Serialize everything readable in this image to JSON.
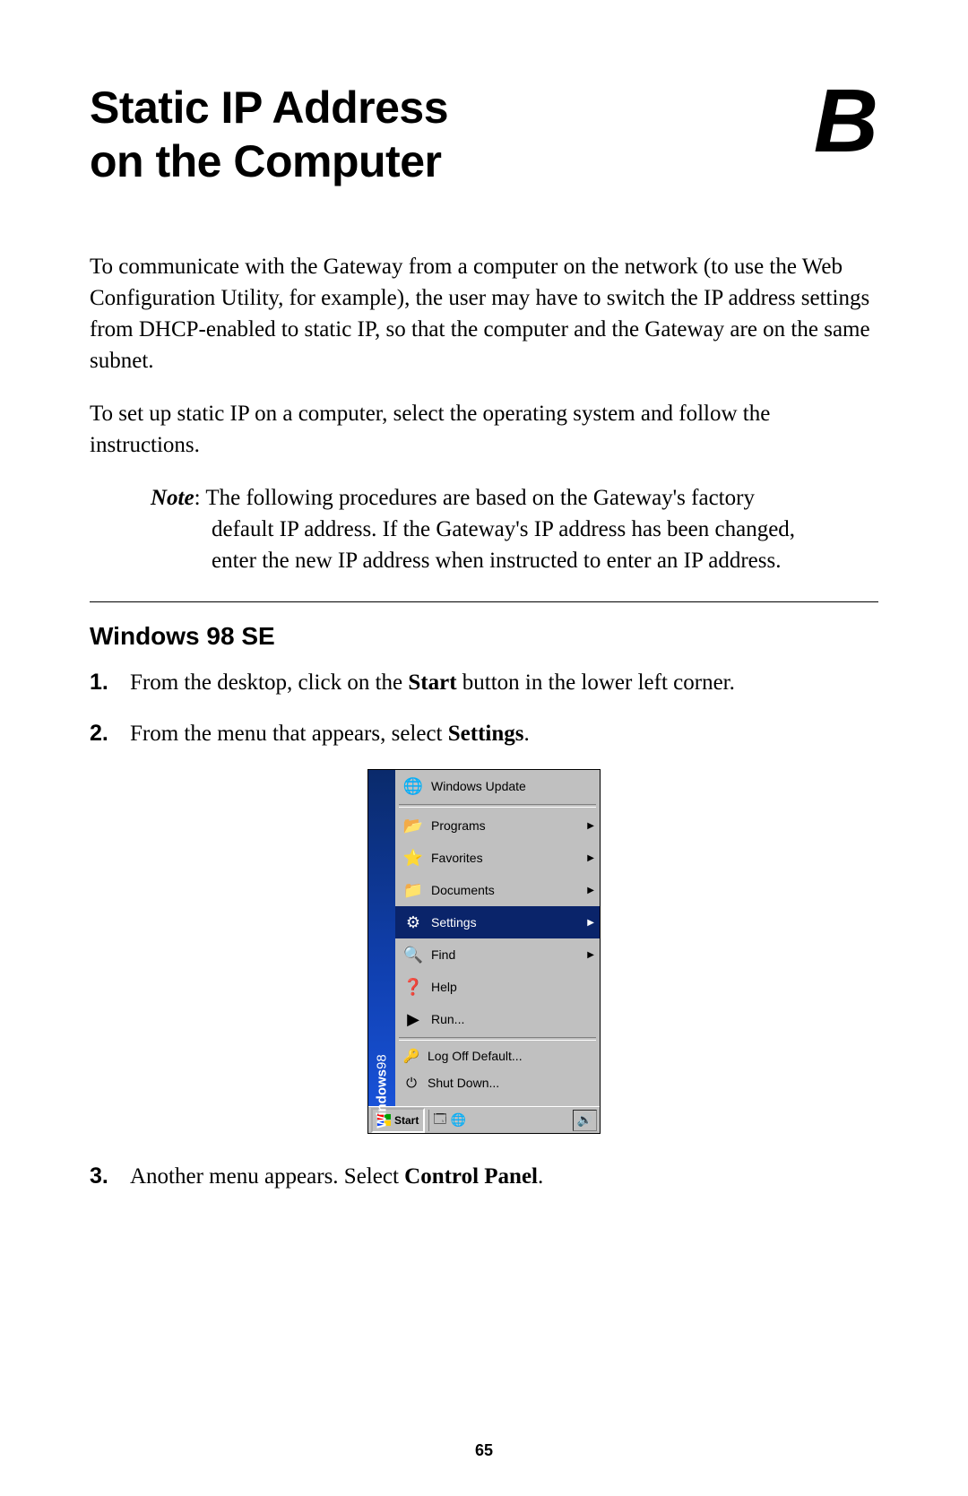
{
  "appendix_letter": "B",
  "title_line1": "Static IP Address",
  "title_line2": "on the Computer",
  "intro_paragraph": "To communicate with the Gateway from a computer on the network (to use the Web Configuration Utility, for example), the user may have to switch the IP address settings from DHCP-enabled to static IP, so that the computer and the Gateway are on the same subnet.",
  "intro_paragraph_2": "To set up static IP on a computer, select the operating system and follow the instructions.",
  "note_label": "Note",
  "note_text_line1": ": The following procedures are based on the Gateway's factory",
  "note_text_line2": "default IP address. If the Gateway's IP address has been changed,",
  "note_text_line3": "enter the new IP address when instructed to enter an IP address.",
  "section_heading": "Windows 98 SE",
  "step1_num": "1.",
  "step1_a": "From the desktop, click on the ",
  "step1_bold": "Start",
  "step1_b": " button in the lower left corner.",
  "step2_num": "2.",
  "step2_a": "From the menu that appears, select ",
  "step2_bold": "Settings",
  "step2_b": ".",
  "step3_num": "3.",
  "step3_a": "Another menu appears. Select ",
  "step3_bold": "Control Panel",
  "step3_b": ".",
  "start_menu": {
    "band_brand": "Windows",
    "band_ver": "98",
    "items": [
      {
        "label": "Windows Update",
        "arrow": false,
        "selected": false,
        "icon": "🌐"
      },
      {
        "label": "Programs",
        "arrow": true,
        "selected": false,
        "icon": "📂"
      },
      {
        "label": "Favorites",
        "arrow": true,
        "selected": false,
        "icon": "⭐"
      },
      {
        "label": "Documents",
        "arrow": true,
        "selected": false,
        "icon": "📁"
      },
      {
        "label": "Settings",
        "arrow": true,
        "selected": true,
        "icon": "⚙"
      },
      {
        "label": "Find",
        "arrow": true,
        "selected": false,
        "icon": "🔍"
      },
      {
        "label": "Help",
        "arrow": false,
        "selected": false,
        "icon": "❓"
      },
      {
        "label": "Run...",
        "arrow": false,
        "selected": false,
        "icon": "▶"
      }
    ],
    "bottom_items": [
      {
        "label": "Log Off Default...",
        "icon": "🔑"
      },
      {
        "label": "Shut Down...",
        "icon": "⏻"
      }
    ],
    "taskbar": {
      "start_label": "Start",
      "quicklaunch": [
        "🗔",
        "🌐"
      ],
      "tray": "🔊"
    }
  },
  "page_number": "65"
}
